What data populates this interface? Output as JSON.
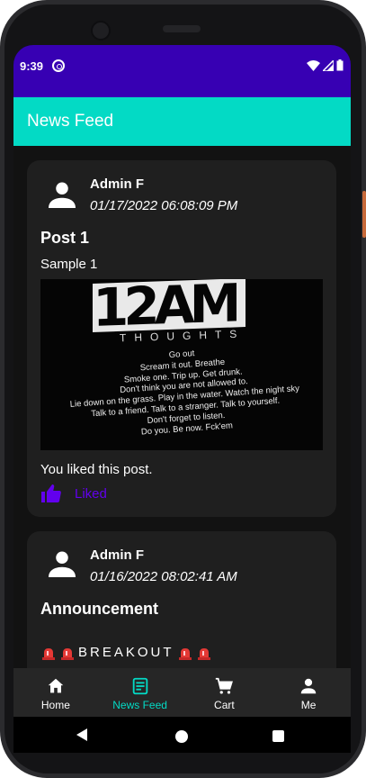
{
  "status_bar": {
    "time": "9:39"
  },
  "app_bar": {
    "title": "News Feed"
  },
  "posts": [
    {
      "author": "Admin F",
      "timestamp": "01/17/2022 06:08:09 PM",
      "title": "Post 1",
      "body": "Sample 1",
      "image": {
        "logo_text": "12AM",
        "subtitle": "THOUGHTS",
        "lines": [
          "Go out",
          "Scream it out. Breathe",
          "Smoke one. Trip up. Get drunk.",
          "Don't think you are not allowed to.",
          "Lie down on the grass. Play in the water. Watch the night sky",
          "Talk to a friend. Talk to a stranger. Talk to yourself.",
          "Don't forget to listen.",
          "Do you. Be now. Fck'em"
        ]
      },
      "like_status": "You liked this post.",
      "like_button_label": "Liked"
    },
    {
      "author": "Admin F",
      "timestamp": "01/16/2022 08:02:41 AM",
      "title": "Announcement",
      "body_text": "BREAKOUT"
    }
  ],
  "bottom_nav": [
    {
      "label": "Home",
      "icon": "home-icon",
      "active": false
    },
    {
      "label": "News Feed",
      "icon": "news-feed-icon",
      "active": true
    },
    {
      "label": "Cart",
      "icon": "cart-icon",
      "active": false
    },
    {
      "label": "Me",
      "icon": "person-icon",
      "active": false
    }
  ],
  "colors": {
    "status_bar": "#3700b3",
    "app_bar": "#03dac5",
    "accent_liked": "#6200ee",
    "active_nav": "#03dac5",
    "background": "#121212",
    "card": "#1f1f1f"
  }
}
